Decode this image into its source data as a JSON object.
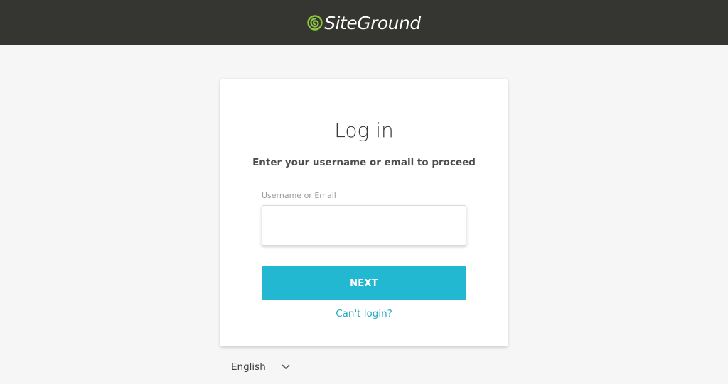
{
  "header": {
    "brand": "SiteGround",
    "logo_icon": "siteground-logo-icon",
    "brand_color": "#8cc63f"
  },
  "login": {
    "title": "Log in",
    "subtitle": "Enter your username or email to proceed",
    "field_label": "Username or Email",
    "field_value": "",
    "next_label": "NEXT",
    "cant_login_label": "Can't login?"
  },
  "footer": {
    "language": "English",
    "language_icon": "chevron-down-icon"
  },
  "colors": {
    "topbar": "#353532",
    "accent": "#22b8d1",
    "link": "#22a9c4",
    "background": "#f6f6f6"
  }
}
